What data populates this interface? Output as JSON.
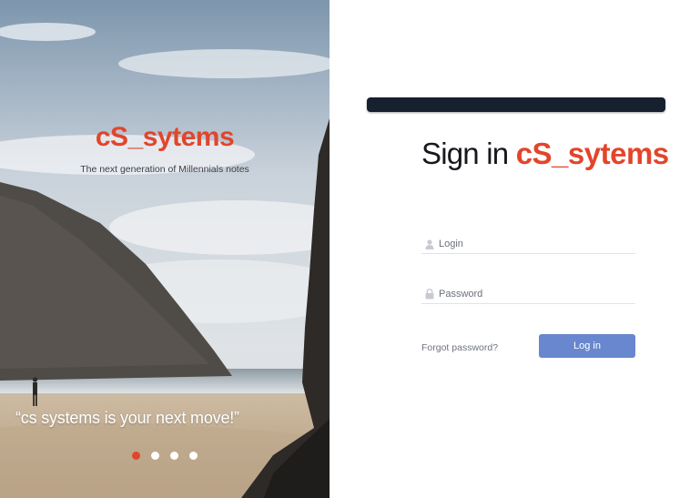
{
  "theme": {
    "accent": "#e2452b",
    "button": "#6987cf",
    "bar": "#17202f"
  },
  "hero": {
    "brand": "cS_sytems",
    "tagline": "The next generation of Millennials notes",
    "quote": "“cs systems is your next move!”",
    "carousel": {
      "total": 4,
      "active_index": 0
    }
  },
  "form": {
    "title_prefix": "Sign in",
    "title_brand": "cS_sytems",
    "login": {
      "placeholder": "Login",
      "value": "",
      "icon": "user-icon"
    },
    "password": {
      "placeholder": "Password",
      "value": "",
      "icon": "lock-icon"
    },
    "forgot_label": "Forgot password?",
    "submit_label": "Log in"
  }
}
